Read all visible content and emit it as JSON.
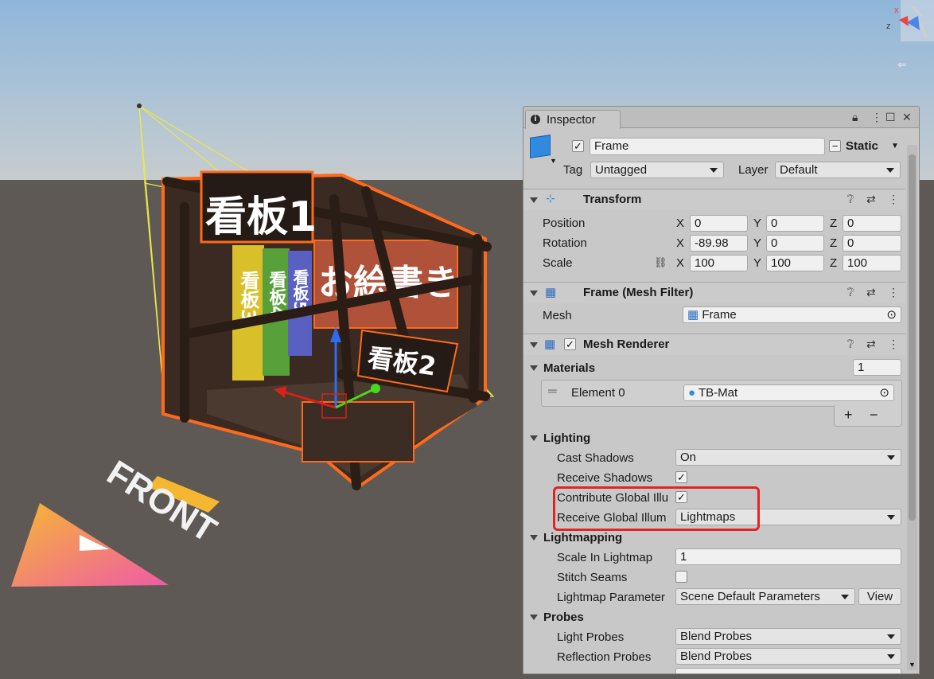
{
  "scene": {
    "sign1": "看板1",
    "sign2": "看板2",
    "sign3": "看板3",
    "sign4": "看板4",
    "sign5": "看板5",
    "banner": "お絵書き",
    "front_label": "FRONT"
  },
  "inspector": {
    "tab_title": "Inspector",
    "object_name": "Frame",
    "static_label": "Static",
    "tag_label": "Tag",
    "tag_value": "Untagged",
    "layer_label": "Layer",
    "layer_value": "Default"
  },
  "transform": {
    "title": "Transform",
    "position_label": "Position",
    "rotation_label": "Rotation",
    "scale_label": "Scale",
    "x": "X",
    "y": "Y",
    "z": "Z",
    "position": [
      "0",
      "0",
      "0"
    ],
    "rotation": [
      "-89.98",
      "0",
      "0"
    ],
    "scale": [
      "100",
      "100",
      "100"
    ]
  },
  "mesh_filter": {
    "title": "Frame (Mesh Filter)",
    "mesh_label": "Mesh",
    "mesh_value": "Frame"
  },
  "mesh_renderer": {
    "title": "Mesh Renderer",
    "materials_label": "Materials",
    "materials_count": "1",
    "element_label": "Element 0",
    "element_value": "TB-Mat",
    "plus": "+",
    "minus": "−",
    "lighting_label": "Lighting",
    "cast_shadows_label": "Cast Shadows",
    "cast_shadows_value": "On",
    "receive_shadows_label": "Receive Shadows",
    "contribute_gi_label": "Contribute Global Illu",
    "receive_gi_label": "Receive Global Illum",
    "receive_gi_value": "Lightmaps",
    "lightmapping_label": "Lightmapping",
    "scale_lightmap_label": "Scale In Lightmap",
    "scale_lightmap_value": "1",
    "stitch_seams_label": "Stitch Seams",
    "lightmap_param_label": "Lightmap Parameter",
    "lightmap_param_value": "Scene Default Parameters",
    "view_button": "View",
    "probes_label": "Probes",
    "light_probes_label": "Light Probes",
    "light_probes_value": "Blend Probes",
    "reflection_probes_label": "Reflection Probes",
    "reflection_probes_value": "Blend Probes"
  },
  "gizmo": {
    "x": "x",
    "z": "z"
  }
}
